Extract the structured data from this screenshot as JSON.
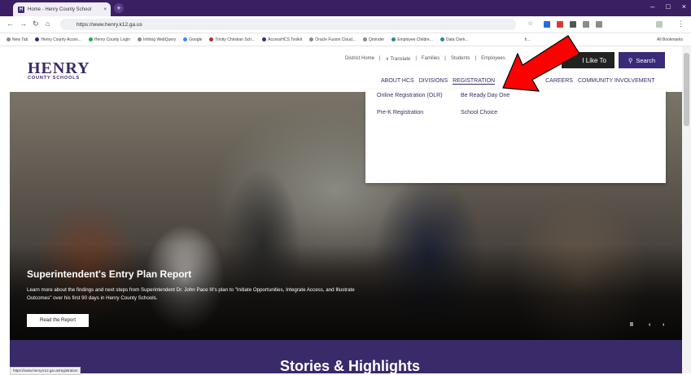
{
  "browser": {
    "tab_title": "Home - Henry County School",
    "tab_favicon": "H",
    "new_tab": "+",
    "window_controls": [
      "–",
      "□",
      "×"
    ],
    "url": "https://www.henry.k12.ga.us",
    "status_url": "https://www.henry.k12.ga.us/registration",
    "bookmarks": [
      "New Tab",
      "Henry County Acces...",
      "Henry County Login",
      "Infolog WebQuery",
      "Google",
      "Trinity Christian Sch...",
      "AccessHCS Toolkit",
      "Oracle Fusion Cloud...",
      "Qminder",
      "Employee Childre...",
      "Data Clerk...",
      "h...",
      "All Bookmarks"
    ]
  },
  "site": {
    "logo_main": "HENRY",
    "logo_sub": "COUNTY SCHOOLS",
    "utility_nav": [
      "District Home",
      "Translate",
      "Families",
      "Students",
      "Employees"
    ],
    "want_label": "I Like To",
    "search_label": "Search",
    "main_nav": [
      "ABOUT HCS",
      "DIVISIONS",
      "REGISTRATION",
      "CAREERS",
      "COMMUNITY INVOLVEMENT"
    ],
    "dropdown": [
      "Online Registration (OLR)",
      "Be Ready Day One",
      "Pre-K Registration",
      "School Choice"
    ],
    "hero_title": "Superintendent's Entry Plan Report",
    "hero_text": "Learn more about the findings and next steps from Superintendent Dr. John Pace III's plan to \"Initiate Opportunities, Integrate Access, and Illustrate Outcomes\" over his first 90 days in Henry County Schools.",
    "hero_button": "Read the Report",
    "carousel_pause": "II",
    "carousel_prev": "‹",
    "carousel_next": "›",
    "stories_title": "Stories & Highlights"
  },
  "colors": {
    "brand_purple": "#3a2a6a",
    "arrow_red": "#ff0000"
  }
}
